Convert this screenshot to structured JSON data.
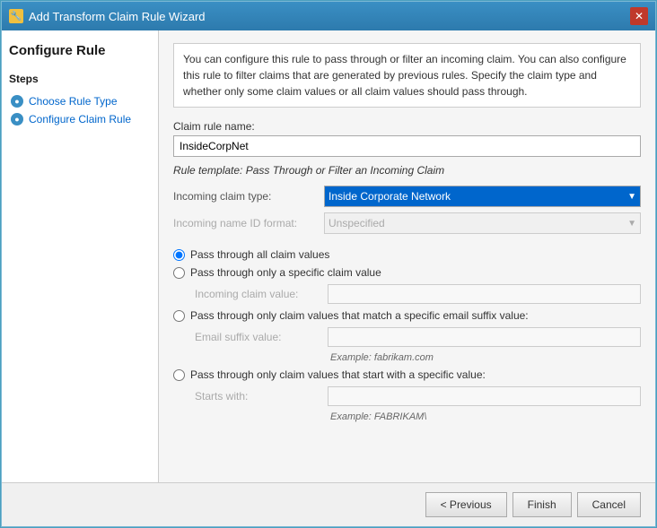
{
  "window": {
    "title": "Add Transform Claim Rule Wizard",
    "title_icon": "🔧",
    "close_label": "✕"
  },
  "page": {
    "title": "Configure Rule"
  },
  "sidebar": {
    "steps_label": "Steps",
    "items": [
      {
        "id": "choose-rule-type",
        "label": "Choose Rule Type",
        "active": false
      },
      {
        "id": "configure-claim-rule",
        "label": "Configure Claim Rule",
        "active": true
      }
    ]
  },
  "main": {
    "description": "You can configure this rule to pass through or filter an incoming claim. You can also configure this rule to filter claims that are generated by previous rules. Specify the claim type and whether only some claim values or all claim values should pass through.",
    "claim_rule_name_label": "Claim rule name:",
    "claim_rule_name_value": "InsideCorpNet",
    "rule_template_text": "Rule template: Pass Through or Filter an Incoming Claim",
    "incoming_claim_type_label": "Incoming claim type:",
    "incoming_claim_type_value": "Inside Corporate Network",
    "incoming_name_id_format_label": "Incoming name ID format:",
    "incoming_name_id_format_value": "Unspecified",
    "radio_options": [
      {
        "id": "pass-all",
        "label": "Pass through all claim values",
        "checked": true
      },
      {
        "id": "pass-specific",
        "label": "Pass through only a specific claim value",
        "checked": false
      },
      {
        "id": "pass-email-suffix",
        "label": "Pass through only claim values that match a specific email suffix value:",
        "checked": false
      },
      {
        "id": "pass-starts-with",
        "label": "Pass through only claim values that start with a specific value:",
        "checked": false
      }
    ],
    "incoming_claim_value_label": "Incoming claim value:",
    "email_suffix_label": "Email suffix value:",
    "email_example": "Example: fabrikam.com",
    "starts_with_label": "Starts with:",
    "starts_with_example": "Example: FABRIKAM\\"
  },
  "footer": {
    "previous_label": "< Previous",
    "finish_label": "Finish",
    "cancel_label": "Cancel"
  }
}
